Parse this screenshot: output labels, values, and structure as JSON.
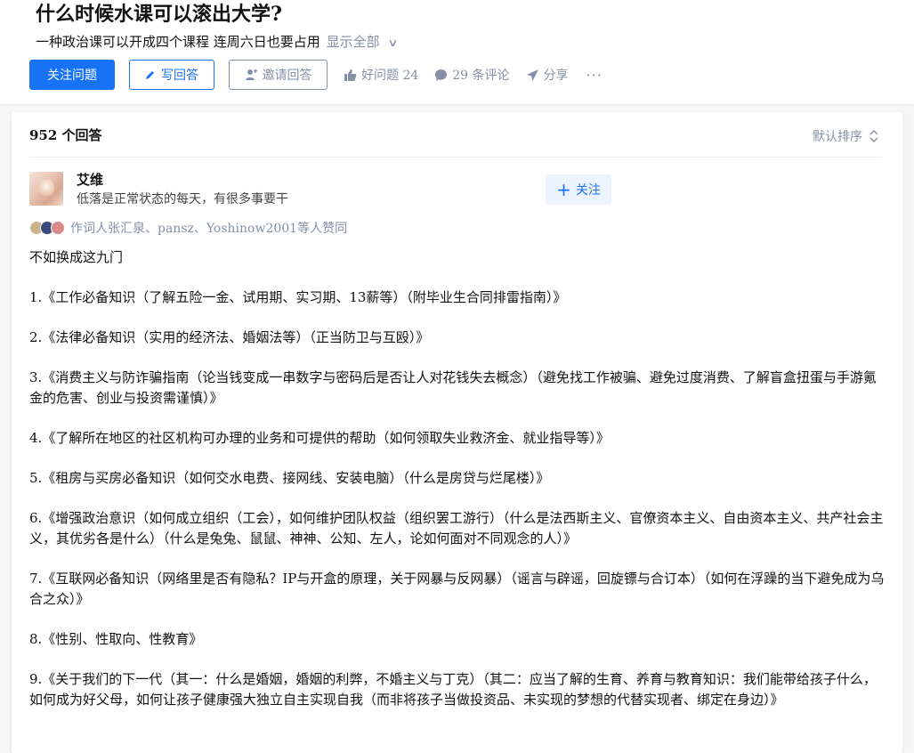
{
  "question": {
    "title": "什么时候水课可以滚出大学?",
    "description": "一种政治课可以开成四个课程 连周六日也要占用",
    "show_all": "显示全部",
    "buttons": {
      "follow": "关注问题",
      "write": "写回答",
      "invite": "邀请回答"
    },
    "meta": {
      "good_question": "好问题 24",
      "comments": "29 条评论",
      "share": "分享",
      "more": "···"
    }
  },
  "answers_header": {
    "count": "952 个回答",
    "sort": "默认排序"
  },
  "answer": {
    "author_name": "艾维",
    "author_bio": "低落是正常状态的每天，有很多事要干",
    "follow_label": "关注",
    "voters": "作词人张汇泉、pansz、Yoshinow2001等人赞同",
    "paragraphs": [
      "不如换成这九门",
      "1.《工作必备知识（了解五险一金、试用期、实习期、13薪等）（附毕业生合同排雷指南）》",
      "2.《法律必备知识（实用的经济法、婚姻法等）（正当防卫与互殴）》",
      "3.《消费主义与防诈骗指南（论当钱变成一串数字与密码后是否让人对花钱失去概念）（避免找工作被骗、避免过度消费、了解盲盒扭蛋与手游氪金的危害、创业与投资需谨慎）》",
      "4.《了解所在地区的社区机构可办理的业务和可提供的帮助（如何领取失业救济金、就业指导等）》",
      "5.《租房与买房必备知识（如何交水电费、接网线、安装电脑）（什么是房贷与烂尾楼）》",
      "6.《增强政治意识（如何成立组织（工会），如何维护团队权益（组织罢工游行）（什么是法西斯主义、官僚资本主义、自由资本主义、共产社会主义，其优劣各是什么）（什么是兔兔、鼠鼠、神神、公知、左人，论如何面对不同观念的人）》",
      "7.《互联网必备知识（网络里是否有隐私？IP与开盒的原理，关于网暴与反网暴）（谣言与辟谣，回旋镖与合订本）（如何在浮躁的当下避免成为乌合之众）》",
      "8.《性别、性取向、性教育》",
      "9.《关于我们的下一代（其一：什么是婚姻，婚姻的利弊，不婚主义与丁克）（其二：应当了解的生育、养育与教育知识：我们能带给孩子什么，如何成为好父母，如何让孩子健康强大独立自主实现自我（而非将孩子当做投资品、未实现的梦想的代替实现者、绑定在身边）》"
    ]
  },
  "colors": {
    "brand_blue": "#1772f6",
    "muted_gray": "#8590a6",
    "text": "#121212"
  }
}
